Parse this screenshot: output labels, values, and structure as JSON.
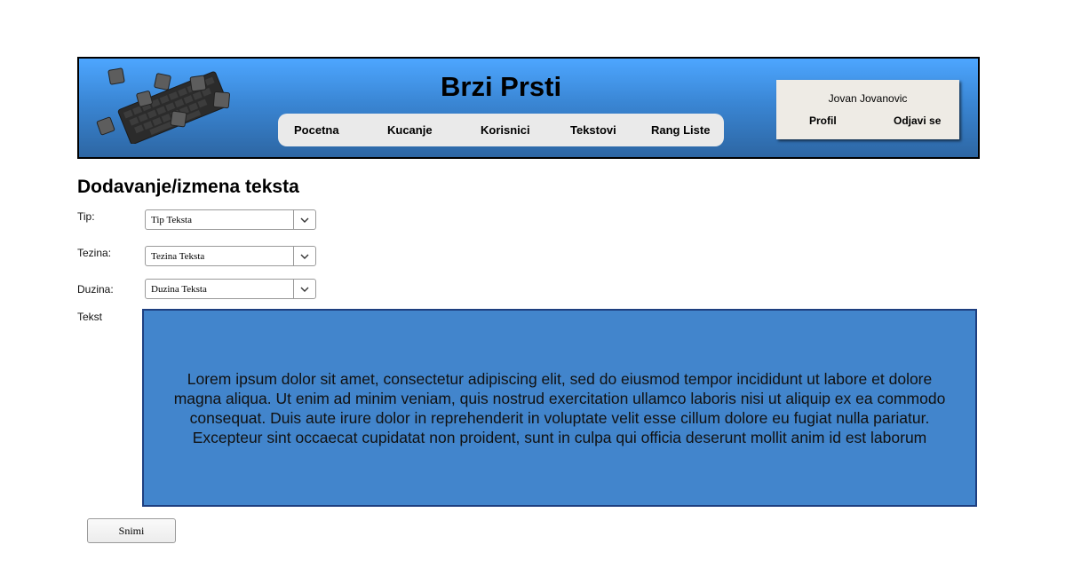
{
  "header": {
    "title": "Brzi Prsti",
    "nav": [
      "Pocetna",
      "Kucanje",
      "Korisnici",
      "Tekstovi",
      "Rang Liste"
    ],
    "user": {
      "name": "Jovan Jovanovic",
      "profile_label": "Profil",
      "logout_label": "Odjavi se"
    }
  },
  "main": {
    "title": "Dodavanje/izmena teksta",
    "fields": {
      "type": {
        "label": "Tip:",
        "value": "Tip Teksta"
      },
      "difficulty": {
        "label": "Tezina:",
        "value": "Tezina Teksta"
      },
      "length": {
        "label": "Duzina:",
        "value": "Duzina Teksta"
      },
      "text": {
        "label": "Tekst",
        "value": "Lorem ipsum dolor sit amet, consectetur adipiscing elit, sed do eiusmod tempor incididunt ut labore et dolore magna aliqua. Ut enim ad minim veniam, quis nostrud exercitation ullamco laboris nisi ut aliquip ex ea commodo consequat. Duis aute irure dolor in reprehenderit in voluptate velit esse cillum dolore eu fugiat nulla pariatur. Excepteur sint occaecat cupidatat non proident, sunt in culpa qui officia deserunt mollit anim id est laborum"
      }
    },
    "save_label": "Snimi"
  },
  "colors": {
    "header_gradient_top": "#4da6ff",
    "header_gradient_bottom": "#2d66a3",
    "text_area_bg": "#4285cc",
    "text_area_border": "#1e3f80",
    "user_box_bg": "#eeebe5"
  },
  "icons": {
    "logo": "keyboard-logo-icon",
    "select_arrow": "chevron-down-icon"
  }
}
